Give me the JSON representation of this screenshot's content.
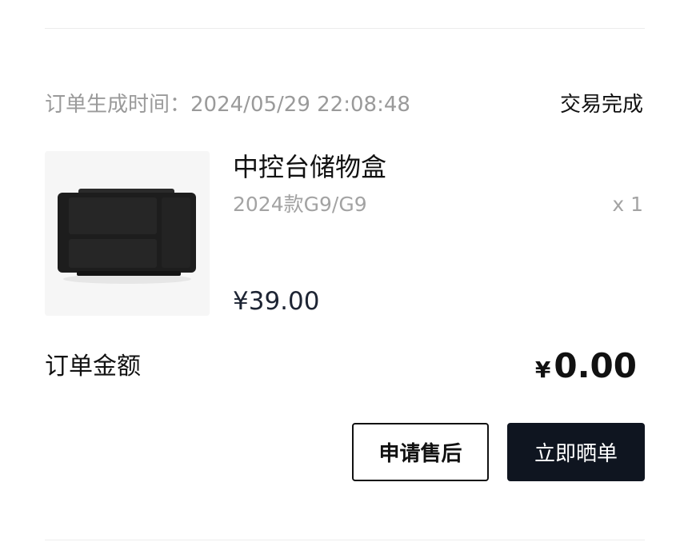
{
  "order": {
    "time_label": "订单生成时间：",
    "time_value": "2024/05/29 22:08:48",
    "status": "交易完成"
  },
  "product": {
    "name": "中控台储物盒",
    "variant": "2024款G9/G9",
    "quantity": "x 1",
    "price": "¥39.00",
    "image_icon": "storage-box-image"
  },
  "total": {
    "label": "订单金额",
    "currency": "¥",
    "amount": "0.00"
  },
  "actions": {
    "after_sale": "申请售后",
    "share_review": "立即晒单"
  },
  "colors": {
    "primary_button": "#0f1520",
    "muted_text": "#9a9a9a",
    "price_text": "#1d2433"
  }
}
